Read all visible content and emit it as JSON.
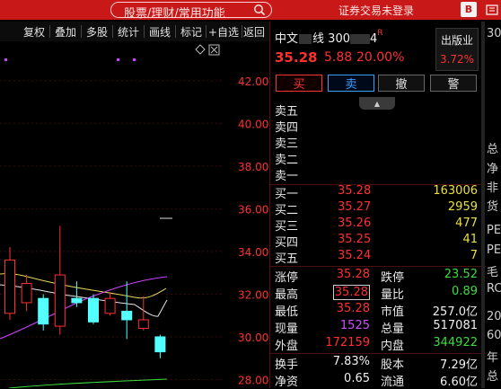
{
  "topbar": {
    "search_placeholder": "股票/理财/常用功能",
    "login_text": "证券交易未登录",
    "icon1_label": "B",
    "icons": [
      "search-icon",
      "badge-icon",
      "menu-icon"
    ]
  },
  "toolbar": {
    "items": [
      "复权",
      "叠加",
      "多股",
      "统计",
      "画线",
      "标记",
      "+自选",
      "返回"
    ]
  },
  "chart": {
    "y_ticks": [
      "42.00",
      "40.00",
      "38.00",
      "36.00",
      "34.00",
      "32.00",
      "30.00",
      "28.00"
    ]
  },
  "chart_data": {
    "type": "candlestick",
    "ylim": [
      27.6,
      43.8
    ],
    "y_ticks": [
      42.0,
      40.0,
      38.0,
      36.0,
      34.0,
      32.0,
      30.0,
      28.0
    ],
    "candles": [
      {
        "open": 31.1,
        "close": 33.6,
        "high": 34.2,
        "low": 30.8,
        "dir": "up"
      },
      {
        "open": 31.6,
        "close": 32.5,
        "high": 32.9,
        "low": 31.2,
        "dir": "up"
      },
      {
        "open": 31.8,
        "close": 30.6,
        "high": 32.0,
        "low": 30.3,
        "dir": "down"
      },
      {
        "open": 30.5,
        "close": 32.9,
        "high": 35.2,
        "low": 30.1,
        "dir": "up"
      },
      {
        "open": 31.8,
        "close": 31.6,
        "high": 32.6,
        "low": 31.4,
        "dir": "down"
      },
      {
        "open": 31.8,
        "close": 30.7,
        "high": 32.0,
        "low": 30.6,
        "dir": "down"
      },
      {
        "open": 31.1,
        "close": 31.8,
        "high": 32.1,
        "low": 31.0,
        "dir": "up"
      },
      {
        "open": 31.2,
        "close": 30.8,
        "high": 32.6,
        "low": 29.9,
        "dir": "down"
      },
      {
        "open": 30.4,
        "close": 30.8,
        "high": 31.9,
        "low": 30.3,
        "dir": "up"
      },
      {
        "open": 30.0,
        "close": 29.3,
        "high": 30.1,
        "low": 29.0,
        "dir": "down"
      }
    ]
  },
  "stock": {
    "name": "中文",
    "name_tail": "线",
    "code": "300",
    "code_tail": "4",
    "badge": "R",
    "price": "35.28",
    "change": "5.88",
    "change_pct": "20.00%",
    "tag": "出版业",
    "tag_pct": "3.72%"
  },
  "trade_buttons": {
    "buy": "买",
    "sell": "卖",
    "cancel": "撤",
    "alert": "警"
  },
  "sell_book": [
    "卖五",
    "卖四",
    "卖三",
    "卖二",
    "卖一"
  ],
  "buy_book": [
    {
      "label": "买一",
      "price": "35.28",
      "volume": "163006"
    },
    {
      "label": "买二",
      "price": "35.27",
      "volume": "2959"
    },
    {
      "label": "买三",
      "price": "35.26",
      "volume": "477"
    },
    {
      "label": "买四",
      "price": "35.25",
      "volume": "41"
    },
    {
      "label": "买五",
      "price": "35.24",
      "volume": "7"
    }
  ],
  "stats": {
    "zhangting_k": "涨停",
    "zhangting_v": "35.28",
    "dieting_k": "跌停",
    "dieting_v": "23.52",
    "zuigao_k": "最高",
    "zuigao_v": "35.28",
    "liangbi_k": "量比",
    "liangbi_v": "0.89",
    "zuidi_k": "最低",
    "zuidi_v": "35.28",
    "shizhi_k": "市值",
    "shizhi_v": "257.0亿",
    "xianliang_k": "现量",
    "xianliang_v": "1525",
    "zongliang_k": "总量",
    "zongliang_v": "517081",
    "waipan_k": "外盘",
    "waipan_v": "172159",
    "neipan_k": "内盘",
    "neipan_v": "344922",
    "huanshou_k": "换手",
    "huanshou_v": "7.83%",
    "guben_k": "股本",
    "guben_v": "7.29亿",
    "jingzi_k": "净资",
    "jingzi_v": "0.65",
    "liutong_k": "流通",
    "liutong_v": "6.60亿"
  },
  "edge_text": [
    "30",
    "总",
    "净",
    "非",
    "货",
    "PE",
    "PE",
    "毛",
    "RC",
    "20",
    "60",
    "年",
    "总"
  ]
}
